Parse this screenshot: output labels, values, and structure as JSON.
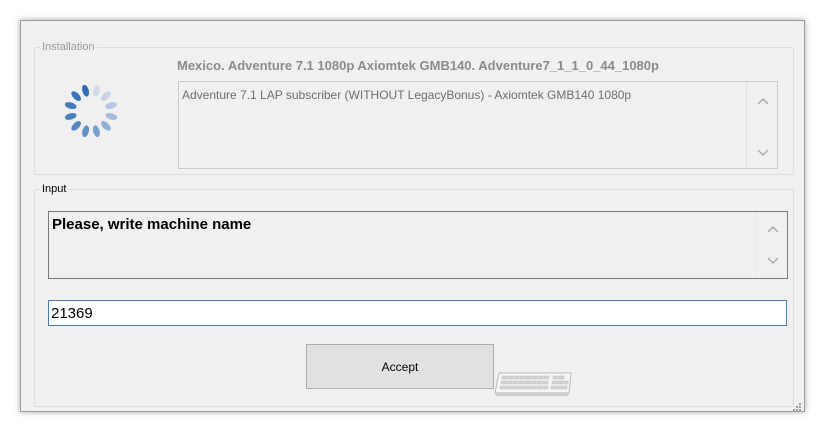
{
  "installation": {
    "group_label": "Installation",
    "heading": "Mexico. Adventure 7.1 1080p Axiomtek GMB140. Adventure7_1_1_0_44_1080p",
    "description": "Adventure 7.1 LAP subscriber (WITHOUT LegacyBonus) - Axiomtek GMB140 1080p",
    "spinner_icon": "loading-spinner-icon"
  },
  "input": {
    "group_label": "Input",
    "prompt": "Please, write machine name",
    "field_value": "21369",
    "accept_label": "Accept",
    "keyboard_icon": "keyboard-icon"
  },
  "colors": {
    "spinner": "#2f6db5",
    "input_border": "#4a7bb5",
    "window_bg": "#f0f0f0"
  }
}
